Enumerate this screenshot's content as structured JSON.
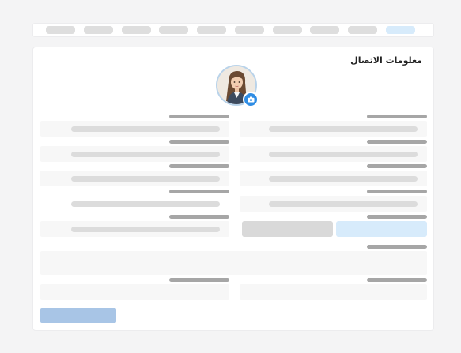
{
  "contact_section": {
    "title": "معلومات الاتصال"
  },
  "avatar": {
    "icon": "person-photo",
    "camera_icon": "camera-icon",
    "accent_color": "#2f8de4"
  },
  "tabs": {
    "count": 10,
    "active_index": 9,
    "active_color": "#d7ebfb"
  },
  "submit_button": {
    "color": "#a8c5e6"
  }
}
